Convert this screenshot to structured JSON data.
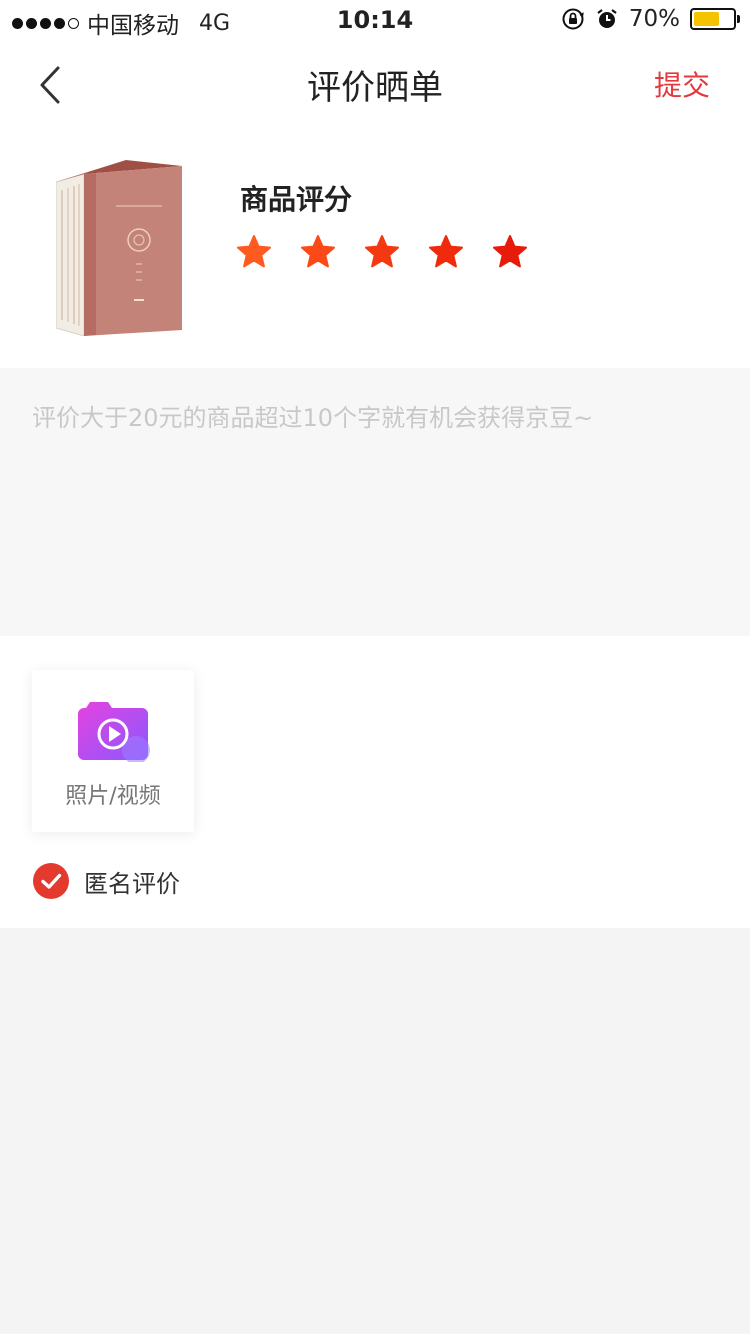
{
  "status_bar": {
    "carrier": "中国移动",
    "network": "4G",
    "time": "10:14",
    "battery": "70%",
    "battery_level": 0.7,
    "battery_color": "#f5c400"
  },
  "nav": {
    "back_icon": "chevron-left-icon",
    "title": "评价晒单",
    "submit": "提交",
    "accent_color": "#e4393c"
  },
  "product": {
    "rating_label": "商品评分",
    "rating": 5,
    "max_rating": 5,
    "star_colors": [
      "#ff5a1f",
      "#fb4a17",
      "#f43812",
      "#ef2a0d",
      "#e81b0a"
    ]
  },
  "review": {
    "placeholder": "评价大于20元的商品超过10个字就有机会获得京豆~"
  },
  "media": {
    "upload_label": "照片/视频",
    "upload_icon": "camera-video-icon",
    "anonymous_label": "匿名评价",
    "anonymous_checked": true
  }
}
